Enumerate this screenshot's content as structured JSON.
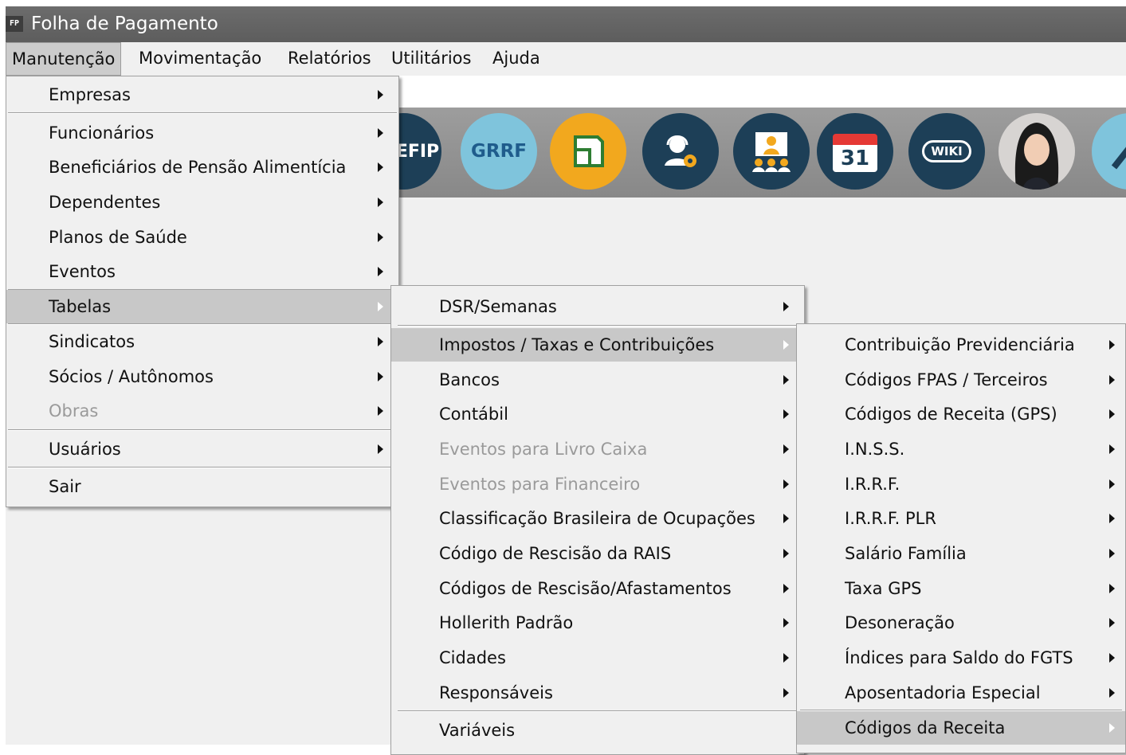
{
  "window": {
    "icon_text": "FP",
    "title": "Folha de Pagamento"
  },
  "menubar": [
    "Manutenção",
    "Movimentação",
    "Relatórios",
    "Utilitários",
    "Ajuda"
  ],
  "toolbar": {
    "sefip_text": "EFIP",
    "grrf_text": "GRRF",
    "calendar_day": "31",
    "wiki_text": "WIKI"
  },
  "menu1": {
    "items": [
      {
        "label": "Empresas"
      },
      {
        "label": "Funcionários"
      },
      {
        "label": "Beneficiários de Pensão Alimentícia"
      },
      {
        "label": "Dependentes"
      },
      {
        "label": "Planos de Saúde"
      },
      {
        "label": "Eventos"
      },
      {
        "label": "Tabelas"
      },
      {
        "label": "Sindicatos"
      },
      {
        "label": "Sócios / Autônomos"
      },
      {
        "label": "Obras"
      },
      {
        "label": "Usuários"
      },
      {
        "label": "Sair"
      }
    ]
  },
  "menu2": {
    "items": [
      {
        "label": "DSR/Semanas"
      },
      {
        "label": "Impostos / Taxas e Contribuições"
      },
      {
        "label": "Bancos"
      },
      {
        "label": "Contábil"
      },
      {
        "label": "Eventos para Livro Caixa"
      },
      {
        "label": "Eventos para Financeiro"
      },
      {
        "label": "Classificação Brasileira de Ocupações"
      },
      {
        "label": "Código de Rescisão da RAIS"
      },
      {
        "label": "Códigos de Rescisão/Afastamentos"
      },
      {
        "label": "Hollerith Padrão"
      },
      {
        "label": "Cidades"
      },
      {
        "label": "Responsáveis"
      },
      {
        "label": "Variáveis"
      }
    ]
  },
  "menu3": {
    "items": [
      {
        "label": "Contribuição Previdenciária"
      },
      {
        "label": "Códigos FPAS / Terceiros"
      },
      {
        "label": "Códigos de Receita (GPS)"
      },
      {
        "label": "I.N.S.S."
      },
      {
        "label": "I.R.R.F."
      },
      {
        "label": "I.R.R.F. PLR"
      },
      {
        "label": "Salário Família"
      },
      {
        "label": "Taxa GPS"
      },
      {
        "label": "Desoneração"
      },
      {
        "label": "Índices para Saldo do FGTS"
      },
      {
        "label": "Aposentadoria Especial"
      },
      {
        "label": "Códigos da Receita"
      }
    ]
  }
}
